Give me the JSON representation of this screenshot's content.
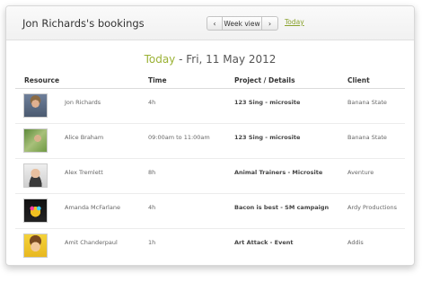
{
  "header": {
    "title": "Jon Richards's bookings",
    "prev_label": "‹",
    "view_label": "Week view",
    "next_label": "›",
    "today_link": "Today"
  },
  "date_heading": {
    "today": "Today",
    "rest": " - Fri, 11 May 2012"
  },
  "table": {
    "columns": [
      "Resource",
      "Time",
      "Project / Details",
      "Client"
    ],
    "rows": [
      {
        "resource": "Jon Richards",
        "time": "4h",
        "project": "123 Sing - microsite",
        "client": "Banana State"
      },
      {
        "resource": "Alice Braham",
        "time": "09:00am to 11:00am",
        "project": "123 Sing - microsite",
        "client": "Banana State"
      },
      {
        "resource": "Alex Tremlett",
        "time": "8h",
        "project": "Animal Trainers - Microsite",
        "client": "Aventure"
      },
      {
        "resource": "Amanda McFarlane",
        "time": "4h",
        "project": "Bacon is best - SM campaign",
        "client": "Ardy Productions"
      },
      {
        "resource": "Amit Chanderpaul",
        "time": "1h",
        "project": "Art Attack - Event",
        "client": "Addis"
      }
    ]
  },
  "colors": {
    "accent": "#9bb235",
    "link": "#8aa22e"
  }
}
